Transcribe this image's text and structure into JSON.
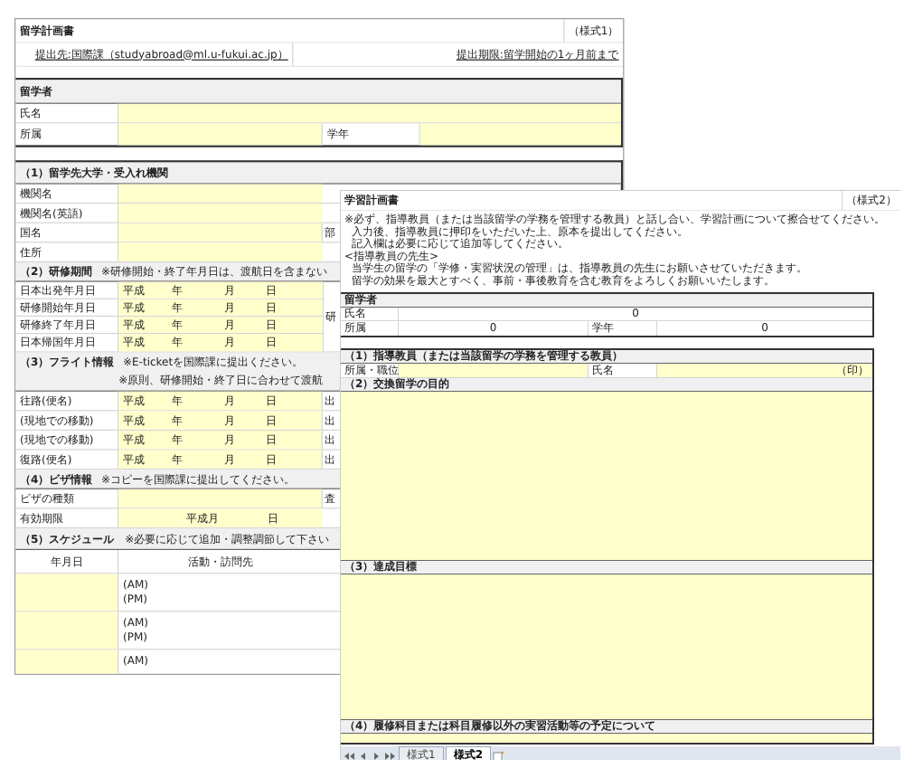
{
  "form_1": {
    "title": "留学計画書",
    "form_no": "（様式1）",
    "submit_to": "提出先:国際課（studyabroad@ml.u-fukui.ac.jp）",
    "deadline": "提出期限:留学開始の1ヶ月前まで",
    "student": {
      "heading": "留学者",
      "name_label": "氏名",
      "affiliation_label": "所属",
      "year_label": "学年"
    },
    "institution": {
      "heading": "（1）留学先大学・受入れ機関",
      "rows": [
        {
          "label": "機関名"
        },
        {
          "label": "機関名(英語)"
        },
        {
          "label": "国名",
          "side": "部"
        },
        {
          "label": "住所"
        }
      ]
    },
    "period": {
      "heading": "（2）研修期間",
      "note": "※研修開始・終了年月日は、渡航日を含まない",
      "side": "研",
      "rows": [
        {
          "label": "日本出発年月日",
          "era": "平成",
          "year": "年",
          "month": "月",
          "day": "日"
        },
        {
          "label": "研修開始年月日",
          "era": "平成",
          "year": "年",
          "month": "月",
          "day": "日"
        },
        {
          "label": "研修終了年月日",
          "era": "平成",
          "year": "年",
          "month": "月",
          "day": "日"
        },
        {
          "label": "日本帰国年月日",
          "era": "平成",
          "year": "年",
          "month": "月",
          "day": "日"
        }
      ]
    },
    "flight": {
      "heading": "（3）フライト情報",
      "notes": [
        "※E-ticketを国際課に提出ください。",
        "※原則、研修開始・終了日に合わせて渡航"
      ],
      "rows": [
        {
          "label": "往路(便名)",
          "era": "平成",
          "year": "年",
          "month": "月",
          "day": "日",
          "side": "出"
        },
        {
          "label": "(現地での移動)",
          "era": "平成",
          "year": "年",
          "month": "月",
          "day": "日",
          "side": "出"
        },
        {
          "label": "(現地での移動)",
          "era": "平成",
          "year": "年",
          "month": "月",
          "day": "日",
          "side": "出"
        },
        {
          "label": "復路(便名)",
          "era": "平成",
          "year": "年",
          "month": "月",
          "day": "日",
          "side": "出"
        }
      ]
    },
    "visa": {
      "heading": "（4）ビザ情報",
      "note": "※コピーを国際課に提出してください。",
      "type_label": "ビザの種類",
      "type_side": "査",
      "expiry_label": "有効期限",
      "era": "平成",
      "month": "月",
      "day": "日"
    },
    "schedule": {
      "heading": "（5）スケジュール",
      "note": "※必要に応じて追加・調整調節して下さい",
      "columns": [
        "年月日",
        "活動・訪問先"
      ],
      "rows": [
        {
          "am": "(AM)",
          "pm": "(PM)"
        },
        {
          "am": "(AM)",
          "pm": "(PM)"
        },
        {
          "am": "(AM)"
        }
      ]
    }
  },
  "form_2": {
    "title": "学習計画書",
    "form_no": "（様式2）",
    "instructions": [
      "※必ず、指導教員（または当該留学の学務を管理する教員）と話し合い、学習計画について擦合せてください。",
      "入力後、指導教員に押印をいただいた上、原本を提出してください。",
      "記入欄は必要に応じて追加等してください。",
      "<指導教員の先生>",
      "当学生の留学の「学修・実習状況の管理」は、指導教員の先生にお願いさせていただきます。",
      "留学の効果を最大とすべく、事前・事後教育を含む教育をよろしくお願いいたします。"
    ],
    "student": {
      "heading": "留学者",
      "name_label": "氏名",
      "name_value": "0",
      "affiliation_label": "所属",
      "affiliation_value": "0",
      "year_label": "学年",
      "year_value": "0"
    },
    "advisor": {
      "heading": "（1）指導教員（または当該留学の学務を管理する教員）",
      "position_label": "所属・職位",
      "name_label": "氏名",
      "seal": "（印）"
    },
    "purpose": {
      "heading": "（2）交換留学の目的"
    },
    "goals": {
      "heading": "（3）達成目標"
    },
    "plan": {
      "heading": "（4）履修科目または科目履修以外の実習活動等の予定について"
    }
  },
  "sheet_tabs": [
    {
      "label": "様式1",
      "selected": false
    },
    {
      "label": "様式2",
      "selected": true
    }
  ]
}
